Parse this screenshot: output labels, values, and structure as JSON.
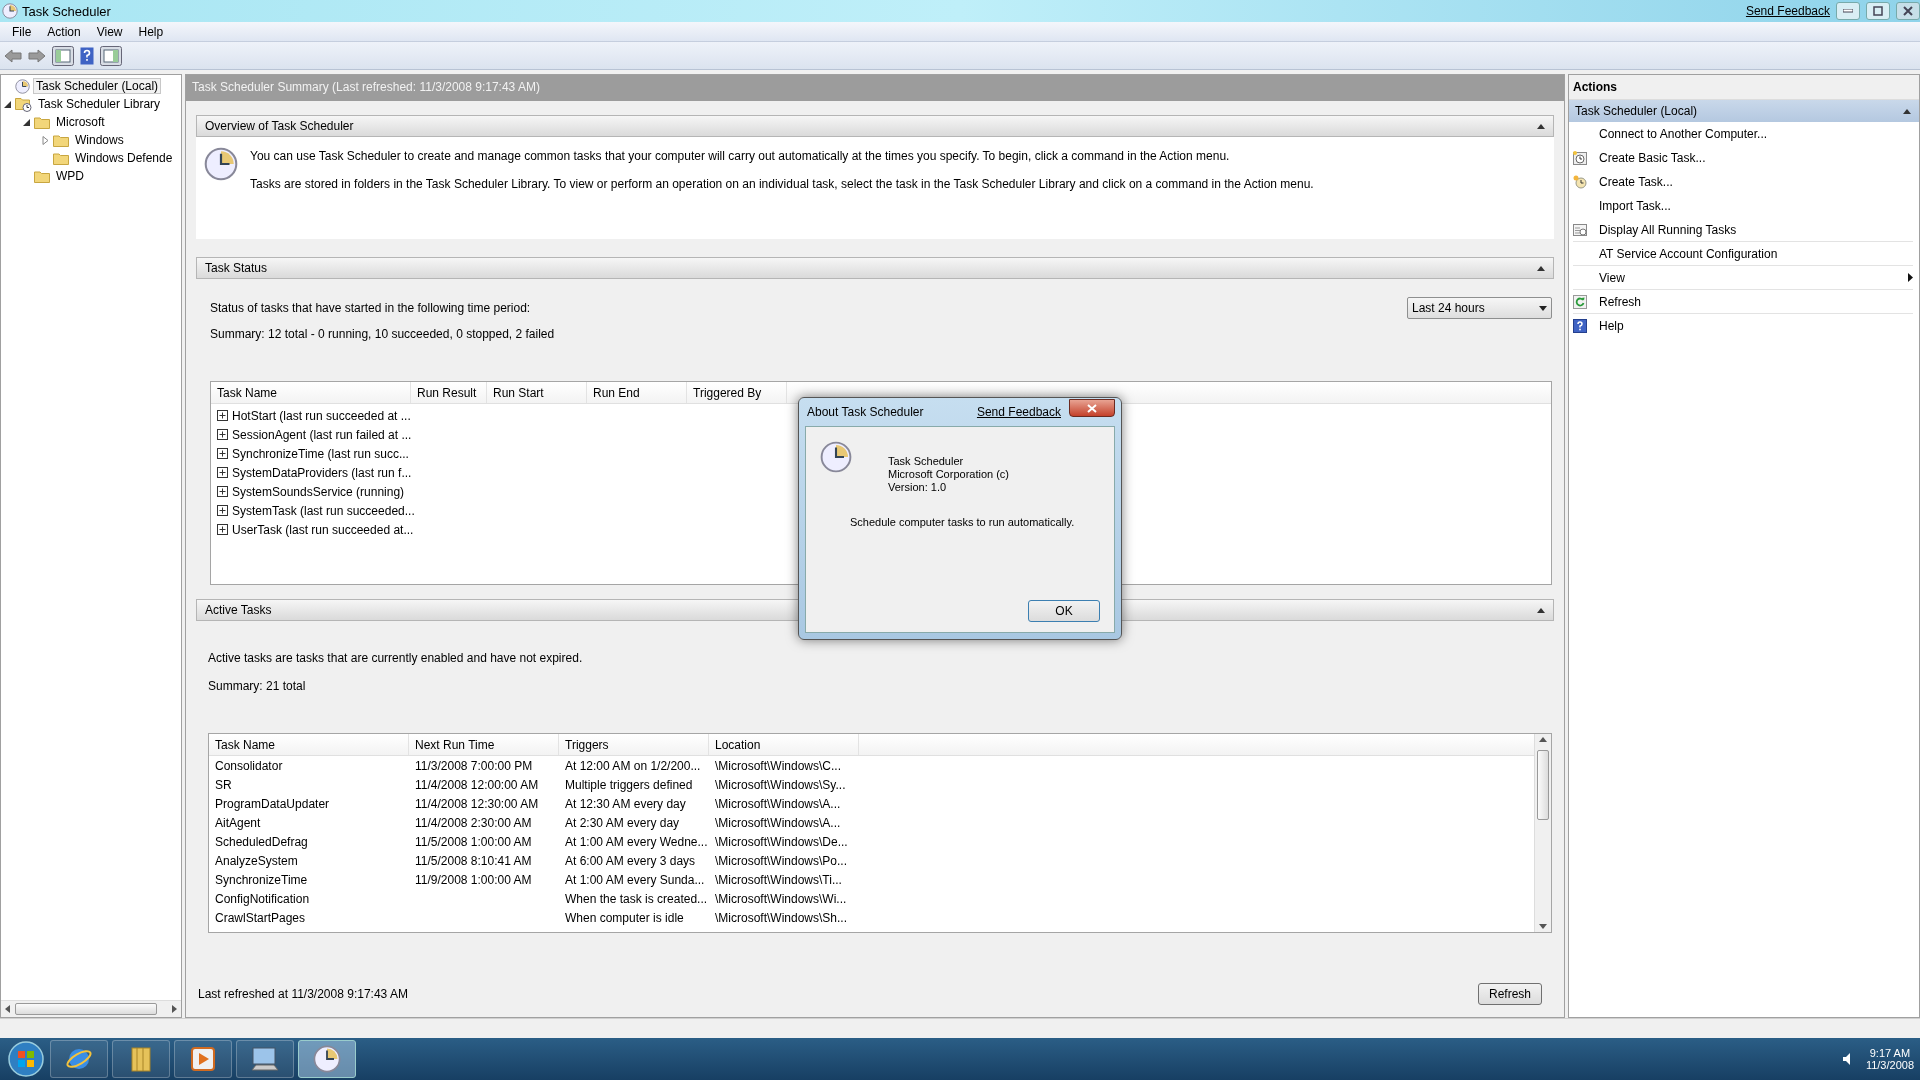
{
  "window": {
    "title": "Task Scheduler",
    "send_feedback": "Send Feedback"
  },
  "menu": [
    "File",
    "Action",
    "View",
    "Help"
  ],
  "tree": [
    {
      "label": "Task Scheduler (Local)",
      "selected": true
    },
    {
      "label": "Task Scheduler Library",
      "selected": false,
      "expanded": true,
      "children": [
        {
          "label": "Microsoft",
          "selected": false,
          "expanded": true,
          "children": [
            {
              "label": "Windows",
              "selected": false,
              "expanded": false
            },
            {
              "label": "Windows Defende",
              "selected": false
            }
          ]
        },
        {
          "label": "WPD",
          "selected": false
        }
      ]
    }
  ],
  "summary_title": "Task Scheduler Summary (Last refreshed: 11/3/2008 9:17:43 AM)",
  "overview": {
    "title": "Overview of Task Scheduler",
    "expanded": true,
    "paragraphs": [
      "You can use Task Scheduler to create and manage common tasks that your computer will carry out automatically at the times you specify. To begin, click a command in the Action menu.",
      "Tasks are stored in folders in the Task Scheduler Library. To view or perform an operation on an individual task, select the task in the Task Scheduler Library and click on a command in the Action menu."
    ]
  },
  "task_status": {
    "title": "Task Status",
    "expanded": true,
    "period_label": "Status of tasks that have started in the following time period:",
    "period_value": "Last 24 hours",
    "summary": "Summary: 12 total - 0 running, 10 succeeded, 0 stopped, 2 failed",
    "columns": [
      "Task Name",
      "Run Result",
      "Run Start",
      "Run End",
      "Triggered By"
    ],
    "rows": [
      {
        "name": "HotStart (last run succeeded at ...",
        "expanded": false
      },
      {
        "name": "SessionAgent (last run failed at ...",
        "expanded": false
      },
      {
        "name": "SynchronizeTime (last run succ...",
        "expanded": false
      },
      {
        "name": "SystemDataProviders (last run f...",
        "expanded": false
      },
      {
        "name": "SystemSoundsService (running)",
        "expanded": false
      },
      {
        "name": "SystemTask (last run succeeded...",
        "expanded": false
      },
      {
        "name": "UserTask (last run succeeded at...",
        "expanded": false
      }
    ]
  },
  "active_tasks": {
    "title": "Active Tasks",
    "expanded": true,
    "description": "Active tasks are tasks that are currently enabled and have not expired.",
    "summary": "Summary: 21 total",
    "columns": [
      "Task Name",
      "Next Run Time",
      "Triggers",
      "Location"
    ],
    "rows": [
      [
        "Consolidator",
        "11/3/2008 7:00:00 PM",
        "At 12:00 AM on 1/2/200...",
        "\\Microsoft\\Windows\\C..."
      ],
      [
        "SR",
        "11/4/2008 12:00:00 AM",
        "Multiple triggers defined",
        "\\Microsoft\\Windows\\Sy..."
      ],
      [
        "ProgramDataUpdater",
        "11/4/2008 12:30:00 AM",
        "At 12:30 AM every day",
        "\\Microsoft\\Windows\\A..."
      ],
      [
        "AitAgent",
        "11/4/2008 2:30:00 AM",
        "At 2:30 AM every day",
        "\\Microsoft\\Windows\\A..."
      ],
      [
        "ScheduledDefrag",
        "11/5/2008 1:00:00 AM",
        "At 1:00 AM every Wedne...",
        "\\Microsoft\\Windows\\De..."
      ],
      [
        "AnalyzeSystem",
        "11/5/2008 8:10:41 AM",
        "At 6:00 AM every 3 days",
        "\\Microsoft\\Windows\\Po..."
      ],
      [
        "SynchronizeTime",
        "11/9/2008 1:00:00 AM",
        "At 1:00 AM every Sunda...",
        "\\Microsoft\\Windows\\Ti..."
      ],
      [
        "ConfigNotification",
        "",
        "When the task is created...",
        "\\Microsoft\\Windows\\Wi..."
      ],
      [
        "CrawlStartPages",
        "",
        "When computer is idle",
        "\\Microsoft\\Windows\\Sh..."
      ]
    ]
  },
  "footer": {
    "text": "Last refreshed at 11/3/2008 9:17:43 AM",
    "button": "Refresh"
  },
  "actions": {
    "title": "Actions",
    "group": "Task Scheduler (Local)",
    "expanded": true,
    "items": [
      {
        "label": "Connect to Another Computer...",
        "kind": "plain"
      },
      {
        "label": "Create Basic Task...",
        "kind": "basic-task"
      },
      {
        "label": "Create Task...",
        "kind": "task"
      },
      {
        "label": "Import Task...",
        "kind": "plain"
      },
      {
        "label": "Display All Running Tasks",
        "kind": "running"
      },
      {
        "label": "AT Service Account Configuration",
        "kind": "plain"
      },
      {
        "label": "View",
        "kind": "submenu"
      },
      {
        "label": "Refresh",
        "kind": "refresh"
      },
      {
        "label": "Help",
        "kind": "help"
      }
    ]
  },
  "dialog": {
    "title": "About Task Scheduler",
    "send_feedback": "Send Feedback",
    "lines": [
      "Task Scheduler",
      "Microsoft Corporation (c)",
      "Version: 1.0"
    ],
    "description": "Schedule computer tasks to run automatically.",
    "ok": "OK"
  },
  "taskbar": {
    "apps": [
      {
        "kind": "browser",
        "selected": false
      },
      {
        "kind": "folder",
        "selected": false
      },
      {
        "kind": "media",
        "selected": false
      },
      {
        "kind": "mmc",
        "selected": false
      },
      {
        "kind": "clock",
        "selected": true
      }
    ],
    "time": "9:17 AM",
    "date": "11/3/2008"
  }
}
